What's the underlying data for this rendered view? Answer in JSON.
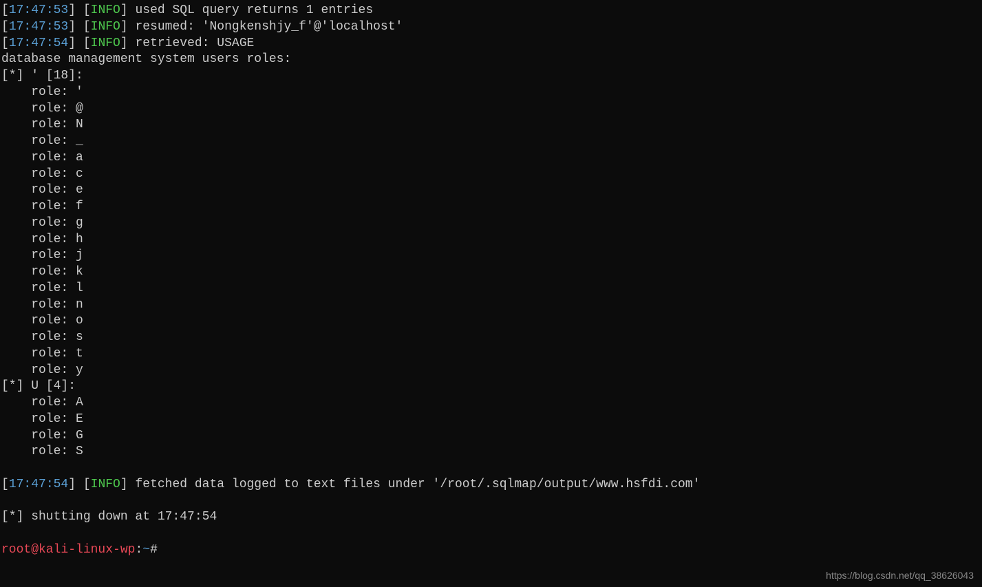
{
  "log_lines": [
    {
      "time": "17:47:53",
      "level": "INFO",
      "msg": "used SQL query returns 1 entries"
    },
    {
      "time": "17:47:53",
      "level": "INFO",
      "msg": "resumed: 'Nongkenshjy_f'@'localhost'"
    },
    {
      "time": "17:47:54",
      "level": "INFO",
      "msg": "retrieved: USAGE"
    }
  ],
  "roles_header": "database management system users roles:",
  "groups": [
    {
      "header": "[*] ' [18]:",
      "roles": [
        "'",
        "@",
        "N",
        "_",
        "a",
        "c",
        "e",
        "f",
        "g",
        "h",
        "j",
        "k",
        "l",
        "n",
        "o",
        "s",
        "t",
        "y"
      ]
    },
    {
      "header": "[*] U [4]:",
      "roles": [
        "A",
        "E",
        "G",
        "S"
      ]
    }
  ],
  "role_prefix": "    role: ",
  "final_log": {
    "time": "17:47:54",
    "level": "INFO",
    "msg": "fetched data logged to text files under '/root/.sqlmap/output/www.hsfdi.com'"
  },
  "shutdown": "[*] shutting down at 17:47:54",
  "prompt": {
    "user": "root@kali-linux-wp",
    "colon": ":",
    "path": "~",
    "hash": "# "
  },
  "watermark": "https://blog.csdn.net/qq_38626043"
}
